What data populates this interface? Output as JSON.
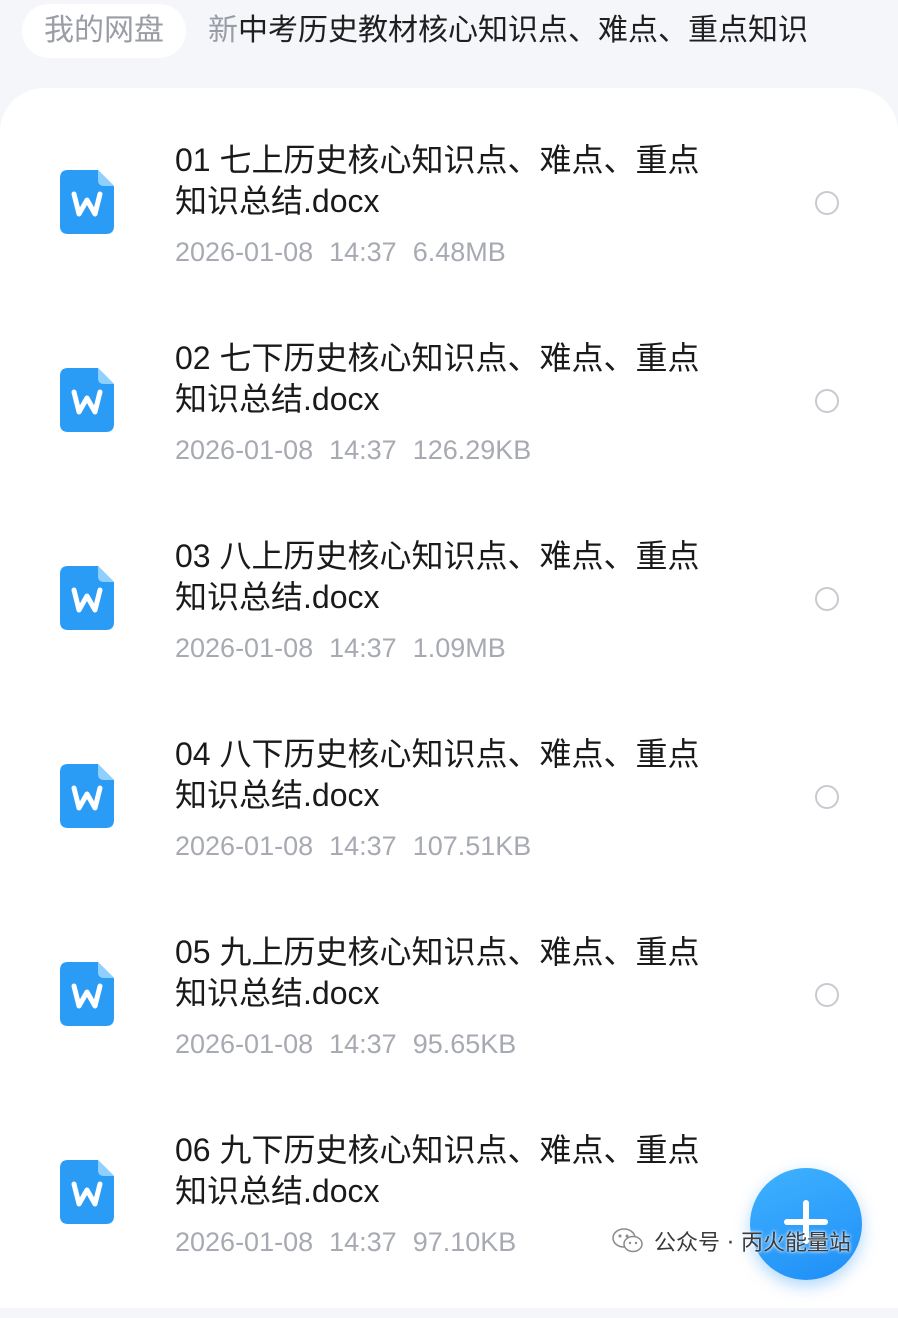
{
  "header": {
    "root_crumb": "我的网盘",
    "current_folder_first": "新",
    "current_folder_rest": "中考历史教材核心知识点、难点、重点知识"
  },
  "files": [
    {
      "name_line1": "01 七上历史核心知识点、难点、重点",
      "name_line2": "知识总结.docx",
      "date": "2026-01-08",
      "time": "14:37",
      "size": "6.48MB",
      "icon": "word-doc-icon"
    },
    {
      "name_line1": "02 七下历史核心知识点、难点、重点",
      "name_line2": "知识总结.docx",
      "date": "2026-01-08",
      "time": "14:37",
      "size": "126.29KB",
      "icon": "word-doc-icon"
    },
    {
      "name_line1": "03 八上历史核心知识点、难点、重点",
      "name_line2": "知识总结.docx",
      "date": "2026-01-08",
      "time": "14:37",
      "size": "1.09MB",
      "icon": "word-doc-icon"
    },
    {
      "name_line1": "04 八下历史核心知识点、难点、重点",
      "name_line2": "知识总结.docx",
      "date": "2026-01-08",
      "time": "14:37",
      "size": "107.51KB",
      "icon": "word-doc-icon"
    },
    {
      "name_line1": "05 九上历史核心知识点、难点、重点",
      "name_line2": "知识总结.docx",
      "date": "2026-01-08",
      "time": "14:37",
      "size": "95.65KB",
      "icon": "word-doc-icon"
    },
    {
      "name_line1": "06 九下历史核心知识点、难点、重点",
      "name_line2": "知识总结.docx",
      "date": "2026-01-08",
      "time": "14:37",
      "size": "97.10KB",
      "icon": "word-doc-icon"
    }
  ],
  "fab": {
    "icon": "plus-icon"
  },
  "watermark": {
    "text": "公众号 · 丙火能量站",
    "icon": "wechat-icon"
  },
  "colors": {
    "accent": "#1f8ef7",
    "doc_icon": "#2b9cf6",
    "meta_text": "#a7aab2"
  }
}
